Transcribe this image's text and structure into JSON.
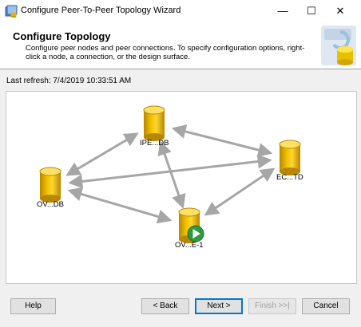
{
  "window": {
    "title": "Configure Peer-To-Peer Topology Wizard",
    "minimize_glyph": "—",
    "maximize_glyph": "☐",
    "close_glyph": "✕"
  },
  "header": {
    "title": "Configure Topology",
    "description": "Configure peer nodes and peer connections. To specify configuration options, right-click a node, a connection, or the design surface."
  },
  "last_refresh": "Last refresh: 7/4/2019 10:33:51 AM",
  "topology": {
    "nodes": [
      {
        "id": "ipe",
        "label": "IPE...DB"
      },
      {
        "id": "ec",
        "label": "EC...TD"
      },
      {
        "id": "ov",
        "label": "OV...DB"
      },
      {
        "id": "ove",
        "label": "OV...E-1",
        "badge": "play-icon"
      }
    ],
    "connections": [
      [
        "ipe",
        "ec"
      ],
      [
        "ipe",
        "ov"
      ],
      [
        "ipe",
        "ove"
      ],
      [
        "ov",
        "ec"
      ],
      [
        "ov",
        "ove"
      ],
      [
        "ove",
        "ec"
      ]
    ],
    "colors": {
      "cylinder": "#e8b400",
      "cylinder_dark": "#b88700",
      "arrow": "#a6a6a6",
      "badge": "#2e9b3e"
    }
  },
  "buttons": {
    "help": "Help",
    "back": "< Back",
    "next": "Next >",
    "finish": "Finish >>|",
    "cancel": "Cancel"
  }
}
